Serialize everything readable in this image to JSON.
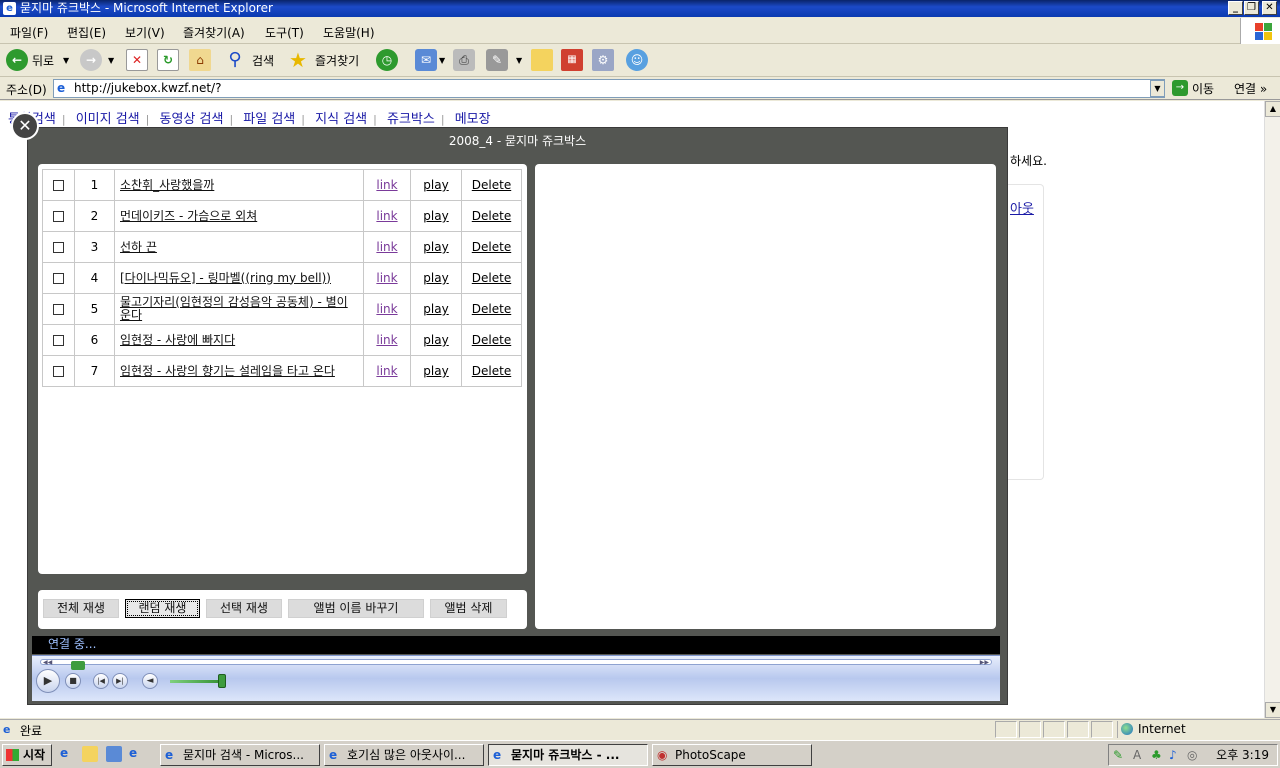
{
  "window": {
    "title": "묻지마 쥬크박스 - Microsoft Internet Explorer",
    "icon": "ie-icon",
    "controls": [
      "_",
      "❐",
      "✕"
    ]
  },
  "menu": [
    "파일(F)",
    "편집(E)",
    "보기(V)",
    "즐겨찾기(A)",
    "도구(T)",
    "도움말(H)"
  ],
  "toolbar": {
    "back_label": "뒤로",
    "search_label": "검색",
    "favorites_label": "즐겨찾기"
  },
  "address": {
    "label": "주소(D)",
    "url": "http://jukebox.kwzf.net/?",
    "go_label": "이동",
    "links_label": "연결 »"
  },
  "page": {
    "nav_links": [
      "통합검색",
      "이미지 검색",
      "동영상 검색",
      "파일 검색",
      "지식 검색",
      "쥬크박스",
      "메모장"
    ],
    "bg_text": "하세요.",
    "bg_link": "아웃"
  },
  "lightbox": {
    "title": "2008_4 - 묻지마 쥬크박스",
    "songs": [
      {
        "num": "1",
        "title": "소찬휘_사랑했을까",
        "link": "link",
        "play": "play",
        "delete": "Delete"
      },
      {
        "num": "2",
        "title": "먼데이키즈 - 가슴으로 외쳐",
        "link": "link",
        "play": "play",
        "delete": "Delete"
      },
      {
        "num": "3",
        "title": "선하 끈",
        "link": "link",
        "play": "play",
        "delete": "Delete"
      },
      {
        "num": "4",
        "title": "[다이나믹듀오] - 링마벨((ring my bell))",
        "link": "link",
        "play": "play",
        "delete": "Delete"
      },
      {
        "num": "5",
        "title": "물고기자리(임현정의 감성음악 공동체) - 별이운다",
        "link": "link",
        "play": "play",
        "delete": "Delete"
      },
      {
        "num": "6",
        "title": "임현정 - 사랑에 빠지다",
        "link": "link",
        "play": "play",
        "delete": "Delete"
      },
      {
        "num": "7",
        "title": "임현정 - 사랑의 향기는 설레임을 타고 온다",
        "link": "link",
        "play": "play",
        "delete": "Delete"
      }
    ],
    "buttons": {
      "play_all": "전체 재생",
      "random_play": "랜덤 재생",
      "selected_play": "선택 재생",
      "rename_album": "앨범 이름 바꾸기",
      "delete_album": "앨범 삭제"
    },
    "player_status": "연결 중..."
  },
  "statusbar": {
    "status": "완료",
    "zone": "Internet"
  },
  "taskbar": {
    "start": "시작",
    "tasks": [
      {
        "label": "묻지마 검색 - Micros...",
        "active": false
      },
      {
        "label": "호기심 많은 아웃사이...",
        "active": false
      },
      {
        "label": "묻지마 쥬크박스 - ...",
        "active": true
      },
      {
        "label": "PhotoScape",
        "active": false
      }
    ],
    "clock": "오후 3:19"
  }
}
